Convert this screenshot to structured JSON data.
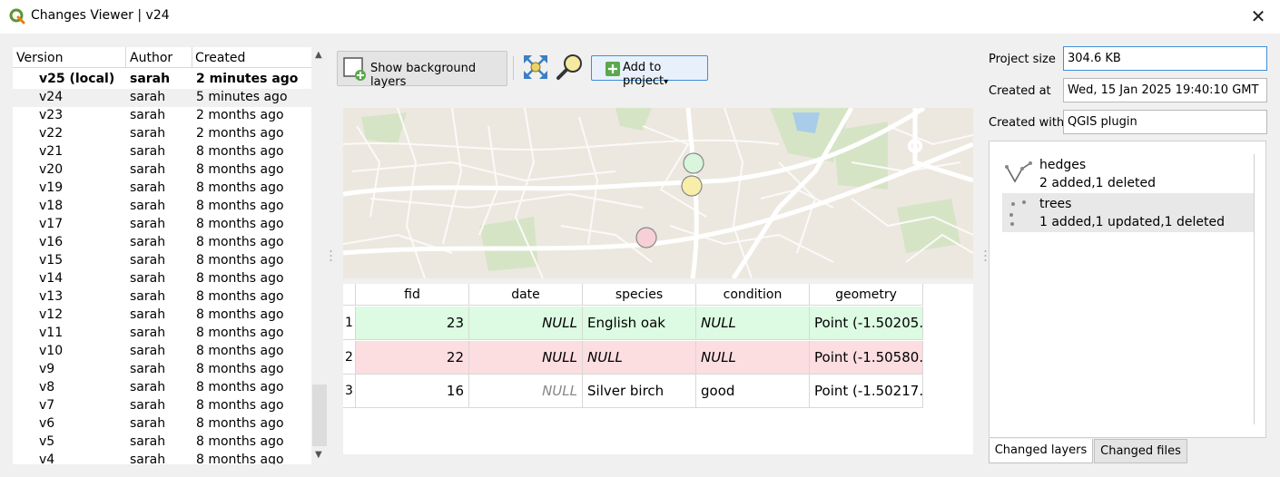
{
  "window": {
    "title": "Changes Viewer | v24",
    "close_glyph": "✕"
  },
  "versions": {
    "columns": [
      "Version",
      "Author",
      "Created"
    ],
    "rows": [
      {
        "version": "v25 (local)",
        "author": "sarah",
        "created": "2 minutes ago",
        "bold": true
      },
      {
        "version": "v24",
        "author": "sarah",
        "created": "5 minutes ago",
        "selected": true
      },
      {
        "version": "v23",
        "author": "sarah",
        "created": "2 months ago"
      },
      {
        "version": "v22",
        "author": "sarah",
        "created": "2 months ago"
      },
      {
        "version": "v21",
        "author": "sarah",
        "created": "8 months ago"
      },
      {
        "version": "v20",
        "author": "sarah",
        "created": "8 months ago"
      },
      {
        "version": "v19",
        "author": "sarah",
        "created": "8 months ago"
      },
      {
        "version": "v18",
        "author": "sarah",
        "created": "8 months ago"
      },
      {
        "version": "v17",
        "author": "sarah",
        "created": "8 months ago"
      },
      {
        "version": "v16",
        "author": "sarah",
        "created": "8 months ago"
      },
      {
        "version": "v15",
        "author": "sarah",
        "created": "8 months ago"
      },
      {
        "version": "v14",
        "author": "sarah",
        "created": "8 months ago"
      },
      {
        "version": "v13",
        "author": "sarah",
        "created": "8 months ago"
      },
      {
        "version": "v12",
        "author": "sarah",
        "created": "8 months ago"
      },
      {
        "version": "v11",
        "author": "sarah",
        "created": "8 months ago"
      },
      {
        "version": "v10",
        "author": "sarah",
        "created": "8 months ago"
      },
      {
        "version": "v9",
        "author": "sarah",
        "created": "8 months ago"
      },
      {
        "version": "v8",
        "author": "sarah",
        "created": "8 months ago"
      },
      {
        "version": "v7",
        "author": "sarah",
        "created": "8 months ago"
      },
      {
        "version": "v6",
        "author": "sarah",
        "created": "8 months ago"
      },
      {
        "version": "v5",
        "author": "sarah",
        "created": "8 months ago"
      },
      {
        "version": "v4",
        "author": "sarah",
        "created": "8 months ago"
      }
    ]
  },
  "toolbar": {
    "show_background_label": "Show background layers",
    "zoom_full_icon": "zoom-full-icon",
    "zoom_selection_icon": "zoom-to-selection-icon",
    "add_to_project_label": "Add to project",
    "dropdown_glyph": "▾"
  },
  "map": {
    "markers": [
      {
        "state": "added",
        "color": "#d9f5dc"
      },
      {
        "state": "updated",
        "color": "#f8eeaa"
      },
      {
        "state": "deleted",
        "color": "#f7d0d6"
      }
    ]
  },
  "features": {
    "columns": [
      "fid",
      "date",
      "species",
      "condition",
      "geometry"
    ],
    "rows": [
      {
        "num": "1",
        "fid": "23",
        "date": "NULL",
        "species": "English oak",
        "condition": "NULL",
        "geometry": "Point (-1.50205…",
        "bg": "#dcfbe2",
        "date_italic": true,
        "species_italic": false,
        "condition_italic": true,
        "date_grey": false
      },
      {
        "num": "2",
        "fid": "22",
        "date": "NULL",
        "species": "NULL",
        "condition": "NULL",
        "geometry": "Point (-1.50580…",
        "bg": "#fcdde0",
        "date_italic": true,
        "species_italic": true,
        "condition_italic": true,
        "date_grey": false
      },
      {
        "num": "3",
        "fid": "16",
        "date": "NULL",
        "species": "Silver birch",
        "condition": "good",
        "geometry": "Point (-1.50217…",
        "bg": "#ffffff",
        "date_italic": true,
        "species_italic": false,
        "condition_italic": false,
        "date_grey": true
      }
    ]
  },
  "info": {
    "project_size_label": "Project size",
    "project_size_value": "304.6 KB",
    "created_at_label": "Created at",
    "created_at_value": "Wed, 15 Jan 2025 19:40:10 GMT",
    "created_with_label": "Created with:",
    "created_with_value": "QGIS plugin"
  },
  "layers": [
    {
      "name": "hedges",
      "summary": "2 added,1 deleted",
      "icon": "line-layer-icon"
    },
    {
      "name": "trees",
      "summary": "1 added,1 updated,1 deleted",
      "icon": "point-layer-icon",
      "selected": true
    }
  ],
  "tabs": {
    "changed_layers": "Changed layers",
    "changed_files": "Changed files"
  },
  "colors": {
    "accent": "#3d8fd8",
    "added": "#dcfbe2",
    "deleted": "#fcdde0",
    "qgis_green": "#589632"
  }
}
